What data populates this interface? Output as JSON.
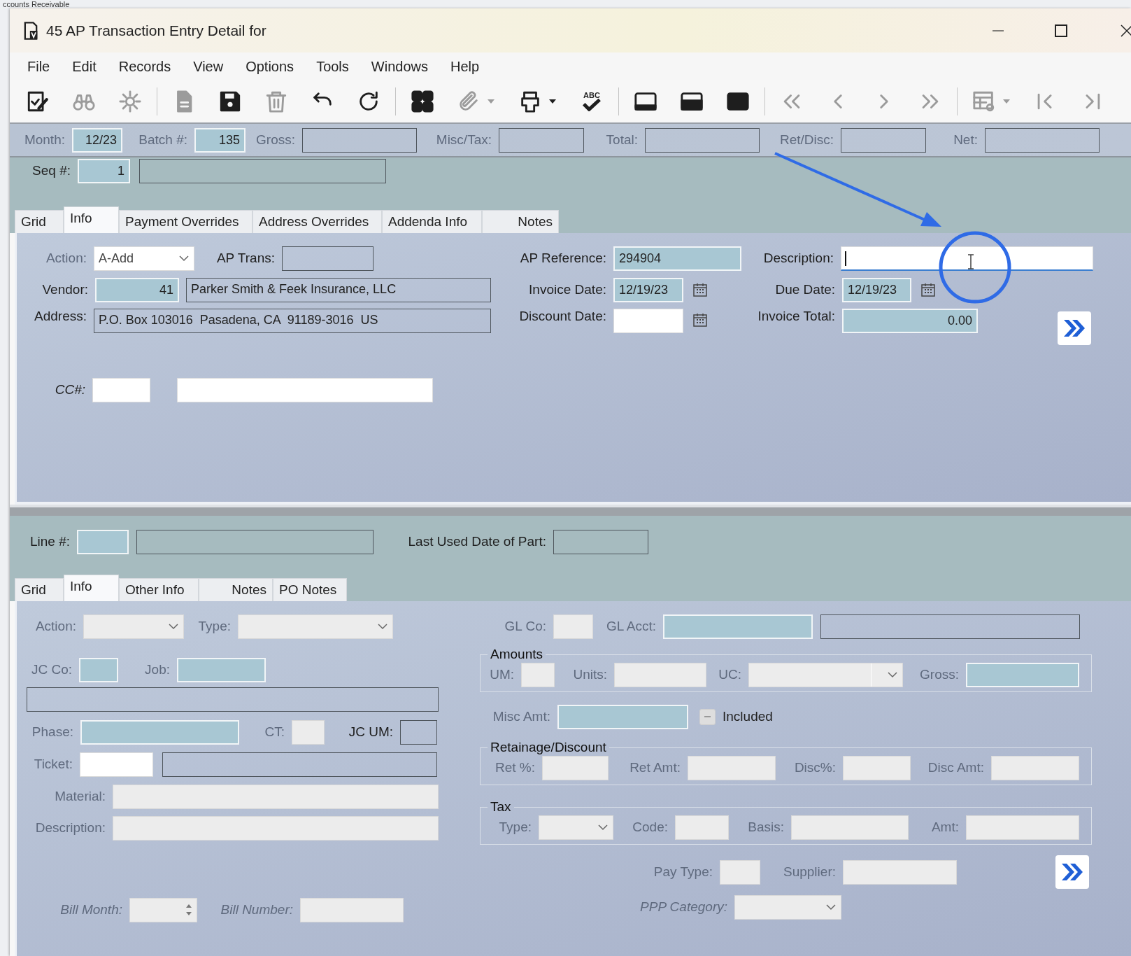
{
  "background_window": {
    "tab_label": "ccounts Receivable"
  },
  "window": {
    "title": "45 AP Transaction Entry Detail for"
  },
  "menu": [
    "File",
    "Edit",
    "Records",
    "View",
    "Options",
    "Tools",
    "Windows",
    "Help"
  ],
  "toolbar": [
    [
      {
        "disabled": false
      },
      {
        "disabled": true
      },
      {
        "disabled": true
      }
    ],
    [
      {
        "disabled": true
      },
      {
        "disabled": false
      },
      {
        "disabled": true
      },
      {
        "disabled": false
      },
      {
        "disabled": false
      }
    ],
    [
      {
        "disabled": false
      },
      {
        "disabled": true,
        "dropdown": true
      },
      {
        "disabled": false,
        "dropdown": true
      },
      {
        "disabled": false,
        "label": "ABC"
      }
    ],
    [
      {
        "disabled": false
      },
      {
        "disabled": false
      },
      {
        "disabled": false
      }
    ],
    [
      {
        "disabled": true
      },
      {
        "disabled": true
      },
      {
        "disabled": true
      },
      {
        "disabled": true
      }
    ],
    [
      {
        "disabled": true,
        "dropdown": true
      },
      {
        "disabled": true
      },
      {
        "disabled": true
      }
    ]
  ],
  "header": {
    "fields": [
      {
        "label": "Month:",
        "disabled": true,
        "kind": "text",
        "key_field": true,
        "value": "12/23"
      },
      {
        "label": "Batch #:",
        "disabled": true,
        "kind": "text",
        "key_field": true,
        "value": "135"
      },
      {
        "label": "Gross:",
        "disabled": true,
        "kind": "text",
        "read_only": true
      },
      {
        "label": "Misc/Tax:",
        "disabled": true,
        "kind": "text",
        "read_only": true
      },
      {
        "label": "Total:",
        "disabled": true,
        "kind": "text",
        "read_only": true
      },
      {
        "label": "Ret/Disc:",
        "disabled": true,
        "kind": "text",
        "read_only": true
      },
      {
        "label": "Net:",
        "disabled": true,
        "kind": "text",
        "read_only": true
      }
    ]
  },
  "seq": {
    "fields": [
      {
        "label": "Seq #:",
        "disabled": false,
        "kind": "text",
        "key_field": true,
        "value": "1"
      },
      {
        "kind": "text",
        "read_only": true
      }
    ]
  },
  "tabs": [
    {
      "label": "Grid",
      "selected": false
    },
    {
      "label": "Info",
      "selected": true
    },
    {
      "label": "Payment Overrides",
      "selected": false
    },
    {
      "label": "Address Overrides",
      "selected": false
    },
    {
      "label": "Addenda Info",
      "selected": false
    },
    {
      "label": "Notes",
      "selected": false
    }
  ],
  "info": {
    "rows": [
      [
        {
          "label": "Action:",
          "disabled": true,
          "kind": "dropdown",
          "editable": true,
          "value": "A-Add"
        },
        {
          "label": "AP Trans:",
          "disabled": false,
          "kind": "text",
          "read_only": true
        },
        {
          "label": "AP Reference:",
          "disabled": false,
          "kind": "text",
          "key_field": true,
          "value": "294904"
        },
        {
          "label": "Description:",
          "disabled": false,
          "kind": "text",
          "editable": true,
          "focused": true
        }
      ],
      [
        {
          "label": "Vendor:",
          "disabled": false,
          "kind": "text",
          "key_field": true,
          "value": "41"
        },
        {
          "kind": "text",
          "read_only": true,
          "value": "Parker Smith & Feek Insurance, LLC"
        },
        {
          "label": "Invoice Date:",
          "disabled": false,
          "kind": "date",
          "key_field": true,
          "value": "12/19/23"
        },
        {
          "label": "Due Date:",
          "disabled": false,
          "kind": "date",
          "key_field": true,
          "value": "12/19/23"
        }
      ],
      [
        {
          "label": "Address:",
          "disabled": false,
          "kind": "text",
          "read_only": true,
          "value": "P.O. Box 103016  Pasadena, CA  91189-3016  US"
        },
        "",
        {
          "label": "Discount Date:",
          "disabled": false,
          "kind": "date",
          "editable": true
        },
        {
          "label": "Invoice Total:",
          "disabled": false,
          "kind": "text",
          "key_field": true,
          "value": "0.00"
        }
      ],
      [
        {
          "label": "CC#:",
          "disabled": false,
          "kind": "text",
          "editable": true
        },
        {
          "kind": "text",
          "editable": true
        }
      ]
    ]
  },
  "line": {
    "fields": [
      {
        "label": "Line #:",
        "disabled": false,
        "kind": "text",
        "key_field": true
      },
      {
        "kind": "text",
        "read_only": true
      },
      {
        "label": "Last Used Date of Part:",
        "disabled": false,
        "kind": "text",
        "read_only": true
      }
    ]
  },
  "line_tabs": [
    {
      "label": "Grid",
      "selected": false
    },
    {
      "label": "Info",
      "selected": true
    },
    {
      "label": "Other Info",
      "selected": false
    },
    {
      "label": "Notes",
      "selected": false
    },
    {
      "label": "PO Notes",
      "selected": false
    }
  ],
  "line_info": {
    "left_rows": [
      [
        {
          "label": "Action:",
          "disabled": true,
          "kind": "dropdown"
        },
        {
          "label": "Type:",
          "disabled": true,
          "kind": "dropdown"
        }
      ],
      [
        {
          "label": "JC Co:",
          "disabled": true,
          "kind": "text",
          "key_field": true
        },
        {
          "label": "Job:",
          "disabled": true,
          "kind": "text",
          "key_field": true
        }
      ],
      [
        {
          "kind": "text",
          "read_only": true
        }
      ],
      [
        {
          "label": "Phase:",
          "disabled": true,
          "kind": "text",
          "key_field": true
        },
        {
          "label": "CT:",
          "disabled": true,
          "kind": "text"
        },
        {
          "label": "JC UM:",
          "disabled": false,
          "kind": "text",
          "read_only": true
        }
      ],
      [
        {
          "label": "Ticket:",
          "disabled": true,
          "kind": "text",
          "editable": true
        },
        {
          "kind": "text",
          "read_only": true
        }
      ],
      [
        {
          "label": "Material:",
          "disabled": true,
          "kind": "text"
        }
      ],
      [
        {
          "label": "Description:",
          "disabled": true,
          "kind": "text"
        }
      ],
      [
        {
          "label": "Bill Month:",
          "disabled": true,
          "kind": "spinner"
        },
        {
          "label": "Bill Number:",
          "disabled": true,
          "kind": "text"
        }
      ]
    ],
    "right_sections": [
      {
        "kind": "row",
        "fields": [
          {
            "label": "GL Co:",
            "disabled": true,
            "kind": "text"
          },
          {
            "label": "GL Acct:",
            "disabled": true,
            "kind": "text",
            "key_field": true
          },
          {
            "kind": "text",
            "read_only": true
          }
        ]
      },
      {
        "kind": "group",
        "title": "Amounts",
        "fields": [
          {
            "label": "UM:",
            "disabled": true,
            "kind": "text"
          },
          {
            "label": "Units:",
            "disabled": true,
            "kind": "text"
          },
          {
            "label": "UC:",
            "disabled": true,
            "kind": "combo"
          },
          {
            "label": "Gross:",
            "disabled": true,
            "kind": "text",
            "key_field": true
          }
        ]
      },
      {
        "kind": "row",
        "fields": [
          {
            "label": "Misc Amt:",
            "disabled": true,
            "kind": "text",
            "key_field": true
          },
          {
            "label": "Included",
            "disabled": true,
            "kind": "checkbox",
            "indeterminate": true
          }
        ]
      },
      {
        "kind": "group",
        "title": "Retainage/Discount",
        "fields": [
          {
            "label": "Ret %:",
            "disabled": true,
            "kind": "text"
          },
          {
            "label": "Ret Amt:",
            "disabled": true,
            "kind": "text"
          },
          {
            "label": "Disc%:",
            "disabled": true,
            "kind": "text"
          },
          {
            "label": "Disc Amt:",
            "disabled": true,
            "kind": "text"
          }
        ]
      },
      {
        "kind": "group",
        "title": "Tax",
        "fields": [
          {
            "label": "Type:",
            "disabled": true,
            "kind": "dropdown"
          },
          {
            "label": "Code:",
            "disabled": true,
            "kind": "text"
          },
          {
            "label": "Basis:",
            "disabled": true,
            "kind": "text"
          },
          {
            "label": "Amt:",
            "disabled": true,
            "kind": "text"
          }
        ]
      },
      {
        "kind": "row",
        "fields": [
          {
            "label": "Pay Type:",
            "disabled": true,
            "kind": "text"
          },
          {
            "label": "Supplier:",
            "disabled": true,
            "kind": "text"
          }
        ]
      },
      {
        "kind": "row",
        "fields": [
          {
            "label": "PPP Category:",
            "disabled": true,
            "kind": "dropdown"
          }
        ]
      }
    ]
  }
}
